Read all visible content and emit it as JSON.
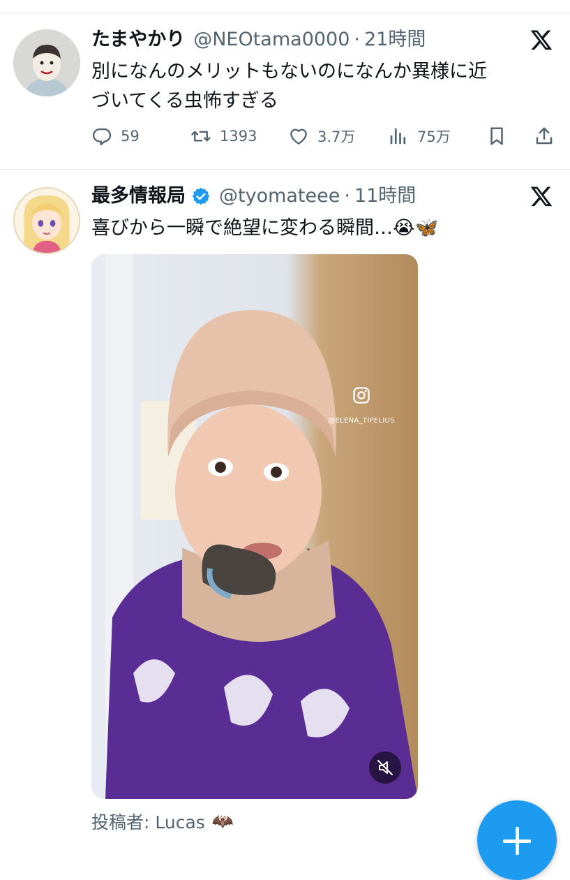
{
  "colors": {
    "accent": "#1d9bf0",
    "text_primary": "#0f1419",
    "text_secondary": "#536471",
    "divider": "#e6e9ec"
  },
  "tweet1": {
    "display_name": "たまやかり",
    "handle": "@NEOtama0000",
    "separator": "·",
    "time": "21時間",
    "text_line1": "別になんのメリットもないのになんか異様に近",
    "text_line2": "づいてくる虫怖すぎる",
    "replies": "59",
    "retweets": "1393",
    "likes": "3.7万",
    "views": "75万",
    "icons": [
      "x-logo-icon",
      "reply-icon",
      "retweet-icon",
      "like-icon",
      "views-icon",
      "bookmark-icon",
      "share-icon"
    ]
  },
  "tweet2": {
    "display_name": "最多情報局",
    "verified": true,
    "handle": "@tyomateee",
    "separator": "·",
    "time": "11時間",
    "text": "喜びから一瞬で絶望に変わる瞬間…😭🦋",
    "media": {
      "type": "video",
      "watermark": "@ELENA_TIPELIUS",
      "muted": true,
      "icons": [
        "instagram-icon",
        "muted-speaker-icon"
      ]
    },
    "posted_by": "投稿者: Lucas",
    "posted_by_emoji": "🦇"
  },
  "fab": {
    "icon": "plus-icon"
  }
}
